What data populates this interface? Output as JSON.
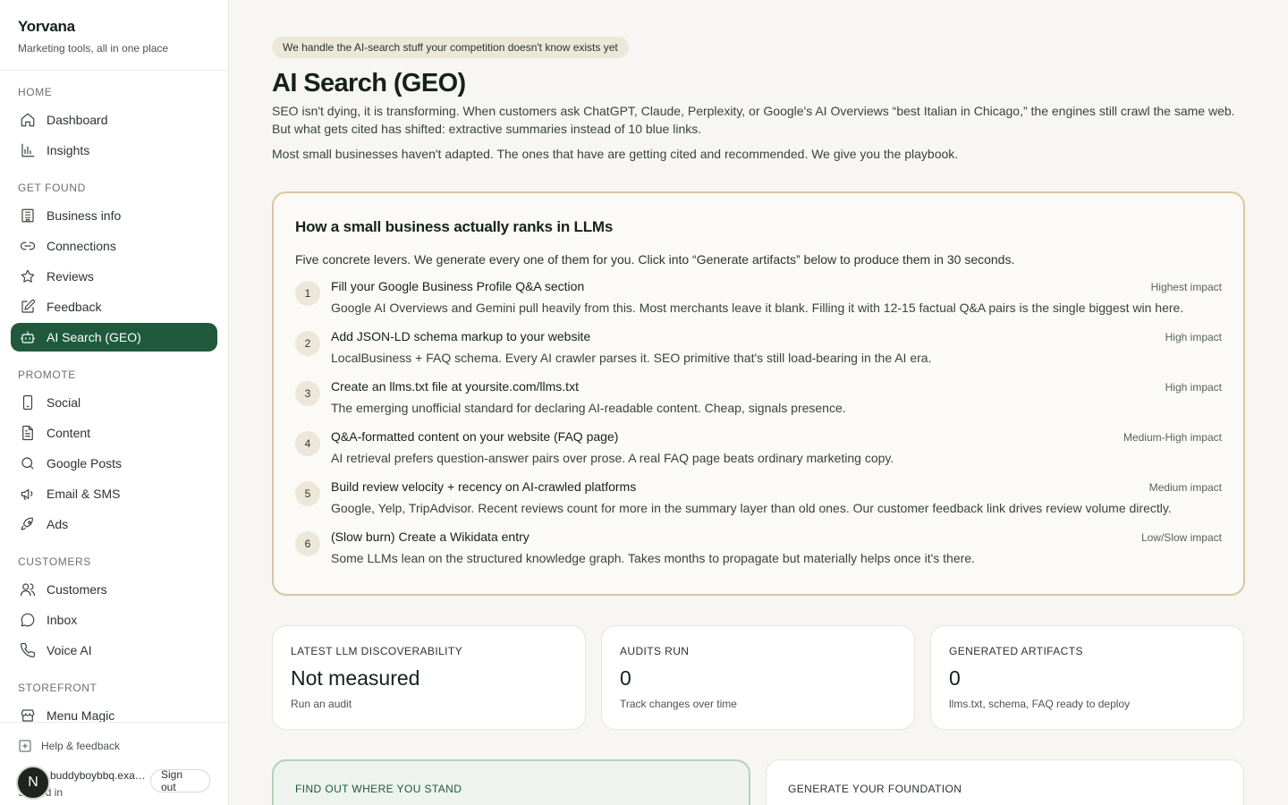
{
  "brand": {
    "name": "Yorvana",
    "tagline": "Marketing tools, all in one place"
  },
  "sidebar": {
    "sections": {
      "home": "HOME",
      "get_found": "GET FOUND",
      "promote": "PROMOTE",
      "customers": "CUSTOMERS",
      "storefront": "STOREFRONT"
    },
    "items": {
      "dashboard": "Dashboard",
      "insights": "Insights",
      "business_info": "Business info",
      "connections": "Connections",
      "reviews": "Reviews",
      "feedback": "Feedback",
      "ai_search": "AI Search (GEO)",
      "social": "Social",
      "content": "Content",
      "google_posts": "Google Posts",
      "email_sms": "Email & SMS",
      "ads": "Ads",
      "customers": "Customers",
      "inbox": "Inbox",
      "voice_ai": "Voice AI",
      "menu_magic": "Menu Magic"
    },
    "active": "ai_search",
    "footer": {
      "help": "Help & feedback",
      "avatar_initial": "N",
      "email": "buddyboybbq.example.com",
      "status": "Signed in",
      "sign_out": "Sign out"
    }
  },
  "main": {
    "pill": "We handle the AI-search stuff your competition doesn't know exists yet",
    "title": "AI Search (GEO)",
    "intro": "SEO isn't dying, it is transforming. When customers ask ChatGPT, Claude, Perplexity, or Google's AI Overviews “best Italian in Chicago,” the engines still crawl the same web. But what gets cited has shifted: extractive summaries instead of 10 blue links.",
    "intro2": "Most small businesses haven't adapted. The ones that have are getting cited and recommended. We give you the playbook.",
    "levers": {
      "title": "How a small business actually ranks in LLMs",
      "subtitle": "Five concrete levers. We generate every one of them for you. Click into “Generate artifacts” below to produce them in 30 seconds.",
      "items": [
        {
          "num": "1",
          "title": "Fill your Google Business Profile Q&A section",
          "impact": "Highest impact",
          "desc": "Google AI Overviews and Gemini pull heavily from this. Most merchants leave it blank. Filling it with 12-15 factual Q&A pairs is the single biggest win here."
        },
        {
          "num": "2",
          "title": "Add JSON-LD schema markup to your website",
          "impact": "High impact",
          "desc": "LocalBusiness + FAQ schema. Every AI crawler parses it. SEO primitive that's still load-bearing in the AI era."
        },
        {
          "num": "3",
          "title": "Create an llms.txt file at yoursite.com/llms.txt",
          "impact": "High impact",
          "desc": "The emerging unofficial standard for declaring AI-readable content. Cheap, signals presence."
        },
        {
          "num": "4",
          "title": "Q&A-formatted content on your website (FAQ page)",
          "impact": "Medium-High impact",
          "desc": "AI retrieval prefers question-answer pairs over prose. A real FAQ page beats ordinary marketing copy."
        },
        {
          "num": "5",
          "title": "Build review velocity + recency on AI-crawled platforms",
          "impact": "Medium impact",
          "desc": "Google, Yelp, TripAdvisor. Recent reviews count for more in the summary layer than old ones. Our customer feedback link drives review volume directly."
        },
        {
          "num": "6",
          "title": "(Slow burn) Create a Wikidata entry",
          "impact": "Low/Slow impact",
          "desc": "Some LLMs lean on the structured knowledge graph. Takes months to propagate but materially helps once it's there."
        }
      ]
    },
    "stats": [
      {
        "label": "LATEST LLM DISCOVERABILITY",
        "value": "Not measured",
        "note": "Run an audit"
      },
      {
        "label": "AUDITS RUN",
        "value": "0",
        "note": "Track changes over time"
      },
      {
        "label": "GENERATED ARTIFACTS",
        "value": "0",
        "note": "llms.txt, schema, FAQ ready to deploy"
      }
    ],
    "cards": {
      "find_out": "FIND OUT WHERE YOU STAND",
      "generate": "GENERATE YOUR FOUNDATION"
    }
  },
  "colors": {
    "accent": "#1f5a3c",
    "pill_bg": "#ece7d8",
    "lever_border": "#d9c7a2"
  }
}
